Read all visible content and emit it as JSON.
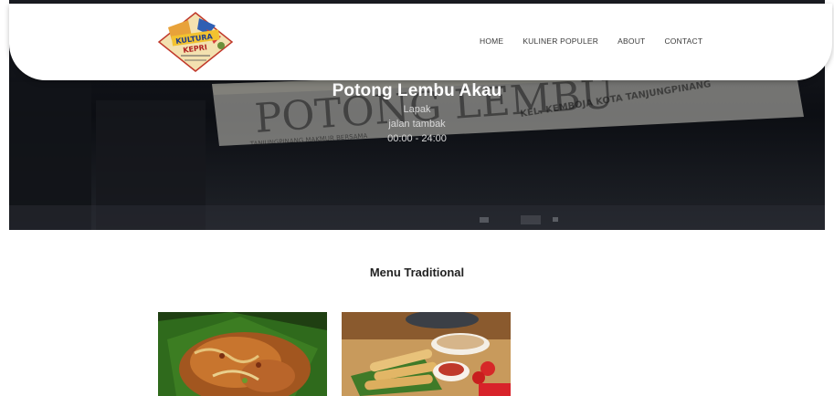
{
  "brand": {
    "logo_lines": [
      "KULTURA",
      "KEPRI"
    ]
  },
  "nav": {
    "items": [
      {
        "label": "HOME"
      },
      {
        "label": "KULINER POPULER"
      },
      {
        "label": "ABOUT"
      },
      {
        "label": "CONTACT"
      }
    ]
  },
  "hero": {
    "title": "Potong Lembu Akau",
    "type": "Lapak",
    "address": "jalan tambak",
    "hours": "00:00 - 24:00",
    "sign_text": "POTONG LEMBU",
    "sign_subtext": "KEL. KEMBOJA KOTA TANJUNGPINANG",
    "sign_left_text": "TANJUNGPINANG MAKMUR BERSAMA"
  },
  "menu": {
    "title": "Menu Traditional"
  },
  "colors": {
    "hero_bg": "#0d0f14",
    "nav_text": "#3a3a3a",
    "heading": "#222222"
  }
}
